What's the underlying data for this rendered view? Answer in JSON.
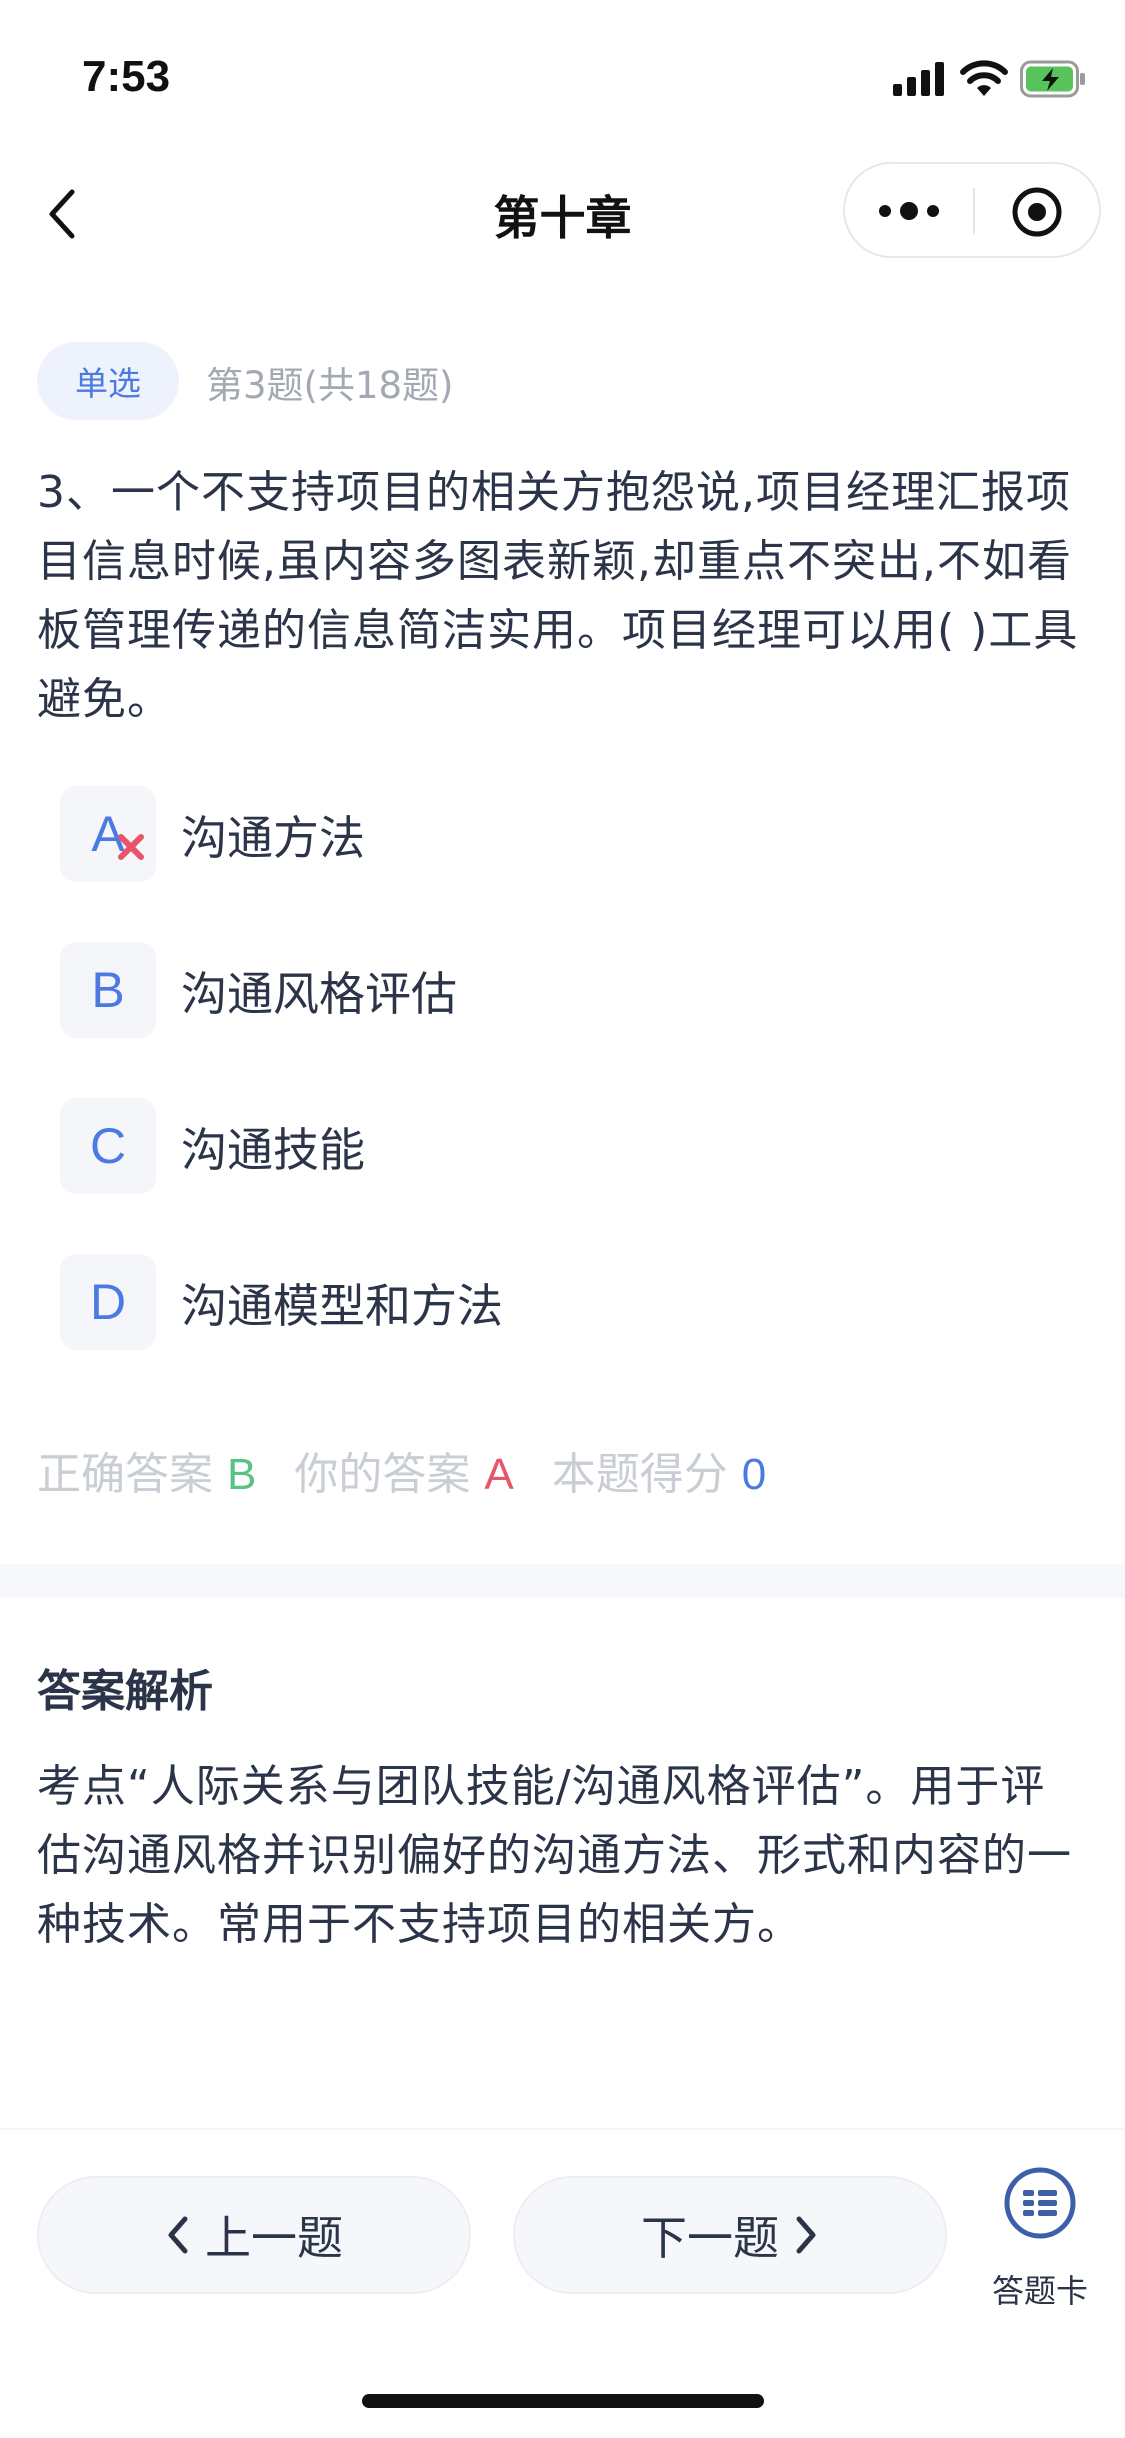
{
  "status_bar": {
    "time": "7:53"
  },
  "nav": {
    "title": "第十章"
  },
  "question": {
    "type_badge": "单选",
    "index_text": "第3题(共18题)",
    "text": "3、一个不支持项目的相关方抱怨说,项目经理汇报项目信息时候,虽内容多图表新颖,却重点不突出,不如看板管理传递的信息简洁实用。项目经理可以用(   )工具避免。"
  },
  "options": [
    {
      "letter": "A",
      "text": "沟通方法",
      "state": "wrong-selected"
    },
    {
      "letter": "B",
      "text": "沟通风格评估"
    },
    {
      "letter": "C",
      "text": "沟通技能"
    },
    {
      "letter": "D",
      "text": "沟通模型和方法"
    }
  ],
  "result": {
    "correct_label": "正确答案",
    "correct_value": "B",
    "user_label": "你的答案",
    "user_value": "A",
    "score_label": "本题得分",
    "score_value": "0"
  },
  "analysis": {
    "title": "答案解析",
    "text": "考点“人际关系与团队技能/沟通风格评估”。用于评估沟通风格并识别偏好的沟通方法、形式和内容的一种技术。常用于不支持项目的相关方。"
  },
  "bottom": {
    "prev_label": "上一题",
    "next_label": "下一题",
    "card_label": "答题卡"
  },
  "colors": {
    "accent": "#4b7ae3",
    "correct": "#59c284",
    "wrong": "#e8546a",
    "muted": "#c9cdd4"
  }
}
